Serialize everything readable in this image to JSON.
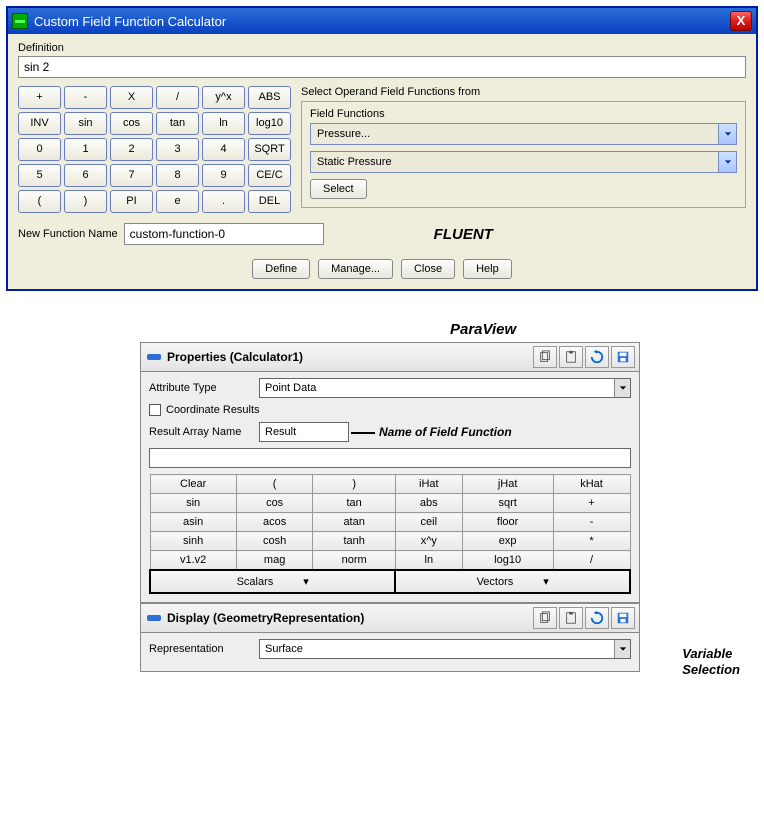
{
  "fluent": {
    "title": "Custom Field Function Calculator",
    "definition_label": "Definition",
    "definition_value": "sin 2",
    "calc_buttons": [
      "+",
      "-",
      "X",
      "/",
      "y^x",
      "ABS",
      "INV",
      "sin",
      "cos",
      "tan",
      "ln",
      "log10",
      "0",
      "1",
      "2",
      "3",
      "4",
      "SQRT",
      "5",
      "6",
      "7",
      "8",
      "9",
      "CE/C",
      "(",
      ")",
      "PI",
      "e",
      ".",
      "DEL"
    ],
    "select_operand_label": "Select Operand Field Functions from",
    "field_functions_label": "Field Functions",
    "field_functions_value": "Pressure...",
    "field_functions_sub_value": "Static Pressure",
    "select_button": "Select",
    "new_function_label": "New Function Name",
    "new_function_value": "custom-function-0",
    "annotation": "FLUENT",
    "footer_buttons": {
      "define": "Define",
      "manage": "Manage...",
      "close": "Close",
      "help": "Help"
    }
  },
  "paraview": {
    "annotation": "ParaView",
    "properties_title": "Properties (Calculator1)",
    "attribute_type_label": "Attribute Type",
    "attribute_type_value": "Point Data",
    "coord_results_label": "Coordinate Results",
    "result_array_label": "Result Array Name",
    "result_array_value": "Result",
    "name_annotation": "Name of Field Function",
    "calc_rows": [
      [
        "Clear",
        "(",
        ")",
        "iHat",
        "jHat",
        "kHat"
      ],
      [
        "sin",
        "cos",
        "tan",
        "abs",
        "sqrt",
        "+"
      ],
      [
        "asin",
        "acos",
        "atan",
        "ceil",
        "floor",
        "-"
      ],
      [
        "sinh",
        "cosh",
        "tanh",
        "x^y",
        "exp",
        "*"
      ],
      [
        "v1.v2",
        "mag",
        "norm",
        "ln",
        "log10",
        "/"
      ]
    ],
    "var_row": {
      "scalars": "Scalars",
      "vectors": "Vectors"
    },
    "var_annotation_1": "Variable",
    "var_annotation_2": "Selection",
    "display_title": "Display (GeometryRepresentation)",
    "representation_label": "Representation",
    "representation_value": "Surface"
  }
}
